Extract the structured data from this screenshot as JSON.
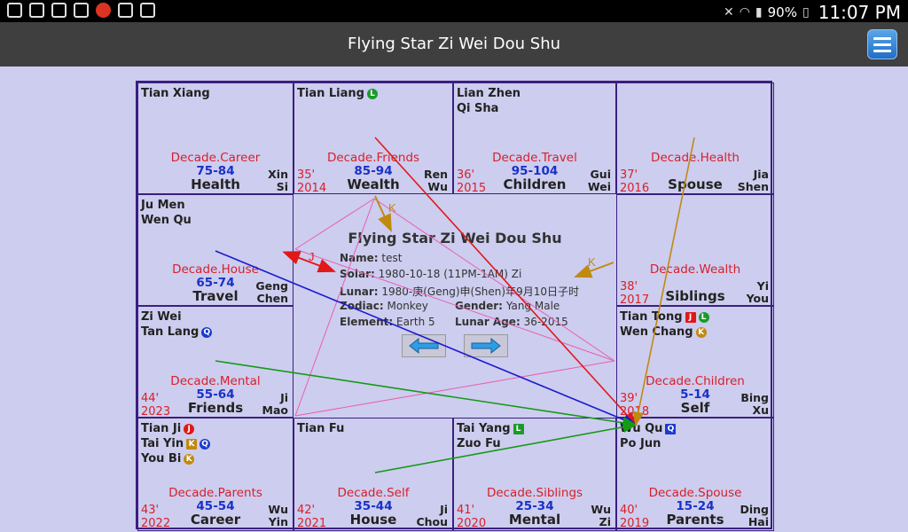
{
  "app": {
    "title": "Flying Star Zi Wei Dou Shu"
  },
  "status_bar": {
    "battery": "90%",
    "time": "11:07 PM"
  },
  "center": {
    "title": "Flying Star Zi Wei Dou Shu",
    "name_label": "Name:",
    "name_value": "test",
    "solar_label": "Solar:",
    "solar_value": "1980-10-18 (11PM-1AM) Zi",
    "lunar_label": "Lunar:",
    "lunar_value": "1980-庚(Geng)申(Shen)年9月10日子时",
    "zodiac_label": "Zodiac:",
    "zodiac_value": "Monkey",
    "gender_label": "Gender:",
    "gender_value": "Yang Male",
    "element_label": "Element:",
    "element_value": "Earth 5",
    "lunar_age_label": "Lunar Age:",
    "lunar_age_value": "36-2015"
  },
  "arrow_labels": {
    "k_top": "K",
    "k_right": "K",
    "j_left": "J"
  },
  "cells": [
    {
      "stars": [
        {
          "name": "Tian Xiang"
        }
      ],
      "decade": "Decade.Career",
      "range": "75-84",
      "palace": "Health",
      "stem1": "Xin",
      "stem2": "Si",
      "age1": "",
      "age2": ""
    },
    {
      "stars": [
        {
          "name": "Tian Liang",
          "badges": [
            {
              "t": "L",
              "c": "#1a9b2a",
              "s": "round"
            }
          ]
        }
      ],
      "decade": "Decade.Friends",
      "range": "85-94",
      "palace": "Wealth",
      "stem1": "Ren",
      "stem2": "Wu",
      "age1": "35'",
      "age2": "2014"
    },
    {
      "stars": [
        {
          "name": "Lian Zhen"
        },
        {
          "name": "Qi Sha"
        }
      ],
      "decade": "Decade.Travel",
      "range": "95-104",
      "palace": "Children",
      "stem1": "Gui",
      "stem2": "Wei",
      "age1": "36'",
      "age2": "2015"
    },
    {
      "stars": [],
      "decade": "Decade.Health",
      "range": "",
      "palace": "Spouse",
      "stem1": "Jia",
      "stem2": "Shen",
      "age1": "37'",
      "age2": "2016"
    },
    {
      "stars": [
        {
          "name": "Ju Men"
        },
        {
          "name": "Wen Qu"
        }
      ],
      "decade": "Decade.House",
      "range": "65-74",
      "palace": "Travel",
      "stem1": "Geng",
      "stem2": "Chen",
      "age1": "",
      "age2": ""
    },
    {
      "stars": [],
      "decade": "Decade.Wealth",
      "range": "",
      "palace": "Siblings",
      "stem1": "Yi",
      "stem2": "You",
      "age1": "38'",
      "age2": "2017"
    },
    {
      "stars": [
        {
          "name": "Zi Wei"
        },
        {
          "name": "Tan Lang",
          "badges": [
            {
              "t": "Q",
              "c": "#1a3ad0",
              "s": "round"
            }
          ]
        }
      ],
      "decade": "Decade.Mental",
      "range": "55-64",
      "palace": "Friends",
      "stem1": "Ji",
      "stem2": "Mao",
      "age1": "44'",
      "age2": "2023"
    },
    {
      "stars": [
        {
          "name": "Tian Tong",
          "badges": [
            {
              "t": "J",
              "c": "#e01818",
              "s": "sq"
            },
            {
              "t": "L",
              "c": "#1a9b2a",
              "s": "round"
            }
          ]
        },
        {
          "name": "Wen Chang",
          "badges": [
            {
              "t": "K",
              "c": "#c08a10",
              "s": "round"
            }
          ]
        }
      ],
      "decade": "Decade.Children",
      "range": "5-14",
      "palace": "Self",
      "stem1": "Bing",
      "stem2": "Xu",
      "age1": "39'",
      "age2": "2018"
    },
    {
      "stars": [
        {
          "name": "Tian Ji",
          "badges": [
            {
              "t": "J",
              "c": "#e01818",
              "s": "round"
            }
          ]
        },
        {
          "name": "Tai Yin",
          "badges": [
            {
              "t": "K",
              "c": "#c08a10",
              "s": "sq"
            },
            {
              "t": "Q",
              "c": "#1a3ad0",
              "s": "round"
            }
          ]
        },
        {
          "name": "You Bi",
          "badges": [
            {
              "t": "K",
              "c": "#c08a10",
              "s": "round"
            }
          ]
        }
      ],
      "decade": "Decade.Parents",
      "range": "45-54",
      "palace": "Career",
      "stem1": "Wu",
      "stem2": "Yin",
      "age1": "43'",
      "age2": "2022"
    },
    {
      "stars": [
        {
          "name": "Tian Fu"
        }
      ],
      "decade": "Decade.Self",
      "range": "35-44",
      "palace": "House",
      "stem1": "Ji",
      "stem2": "Chou",
      "age1": "42'",
      "age2": "2021"
    },
    {
      "stars": [
        {
          "name": "Tai Yang",
          "badges": [
            {
              "t": "L",
              "c": "#1a9b2a",
              "s": "sq"
            }
          ]
        },
        {
          "name": "Zuo Fu"
        }
      ],
      "decade": "Decade.Siblings",
      "range": "25-34",
      "palace": "Mental",
      "stem1": "Wu",
      "stem2": "Zi",
      "age1": "41'",
      "age2": "2020"
    },
    {
      "stars": [
        {
          "name": "Wu Qu",
          "badges": [
            {
              "t": "Q",
              "c": "#1a3ad0",
              "s": "sq"
            }
          ]
        },
        {
          "name": "Po Jun"
        }
      ],
      "decade": "Decade.Spouse",
      "range": "15-24",
      "palace": "Parents",
      "stem1": "Ding",
      "stem2": "Hai",
      "age1": "40'",
      "age2": "2019"
    }
  ]
}
